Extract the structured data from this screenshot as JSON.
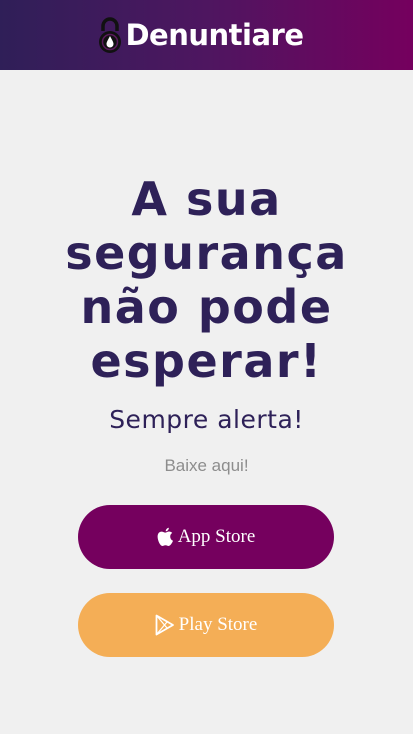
{
  "navbar": {
    "brand_name": "Denuntiare",
    "brand_icon": "padlock-icon",
    "gradient_colors": [
      "#2f1f58",
      "#75005e"
    ]
  },
  "hero": {
    "title": "A sua segurança não pode esperar!",
    "tagline": "Sempre alerta!",
    "download_hint": "Baixe aqui!"
  },
  "buttons": {
    "app_store": {
      "label": "App Store",
      "icon": "apple-icon",
      "color": "#75005e"
    },
    "play_store": {
      "label": "Play Store",
      "icon": "play-store-icon",
      "color": "#f4ae56"
    }
  },
  "colors": {
    "background": "#f0f0f0",
    "heading": "#2e2158",
    "muted": "#8d8d8d"
  }
}
